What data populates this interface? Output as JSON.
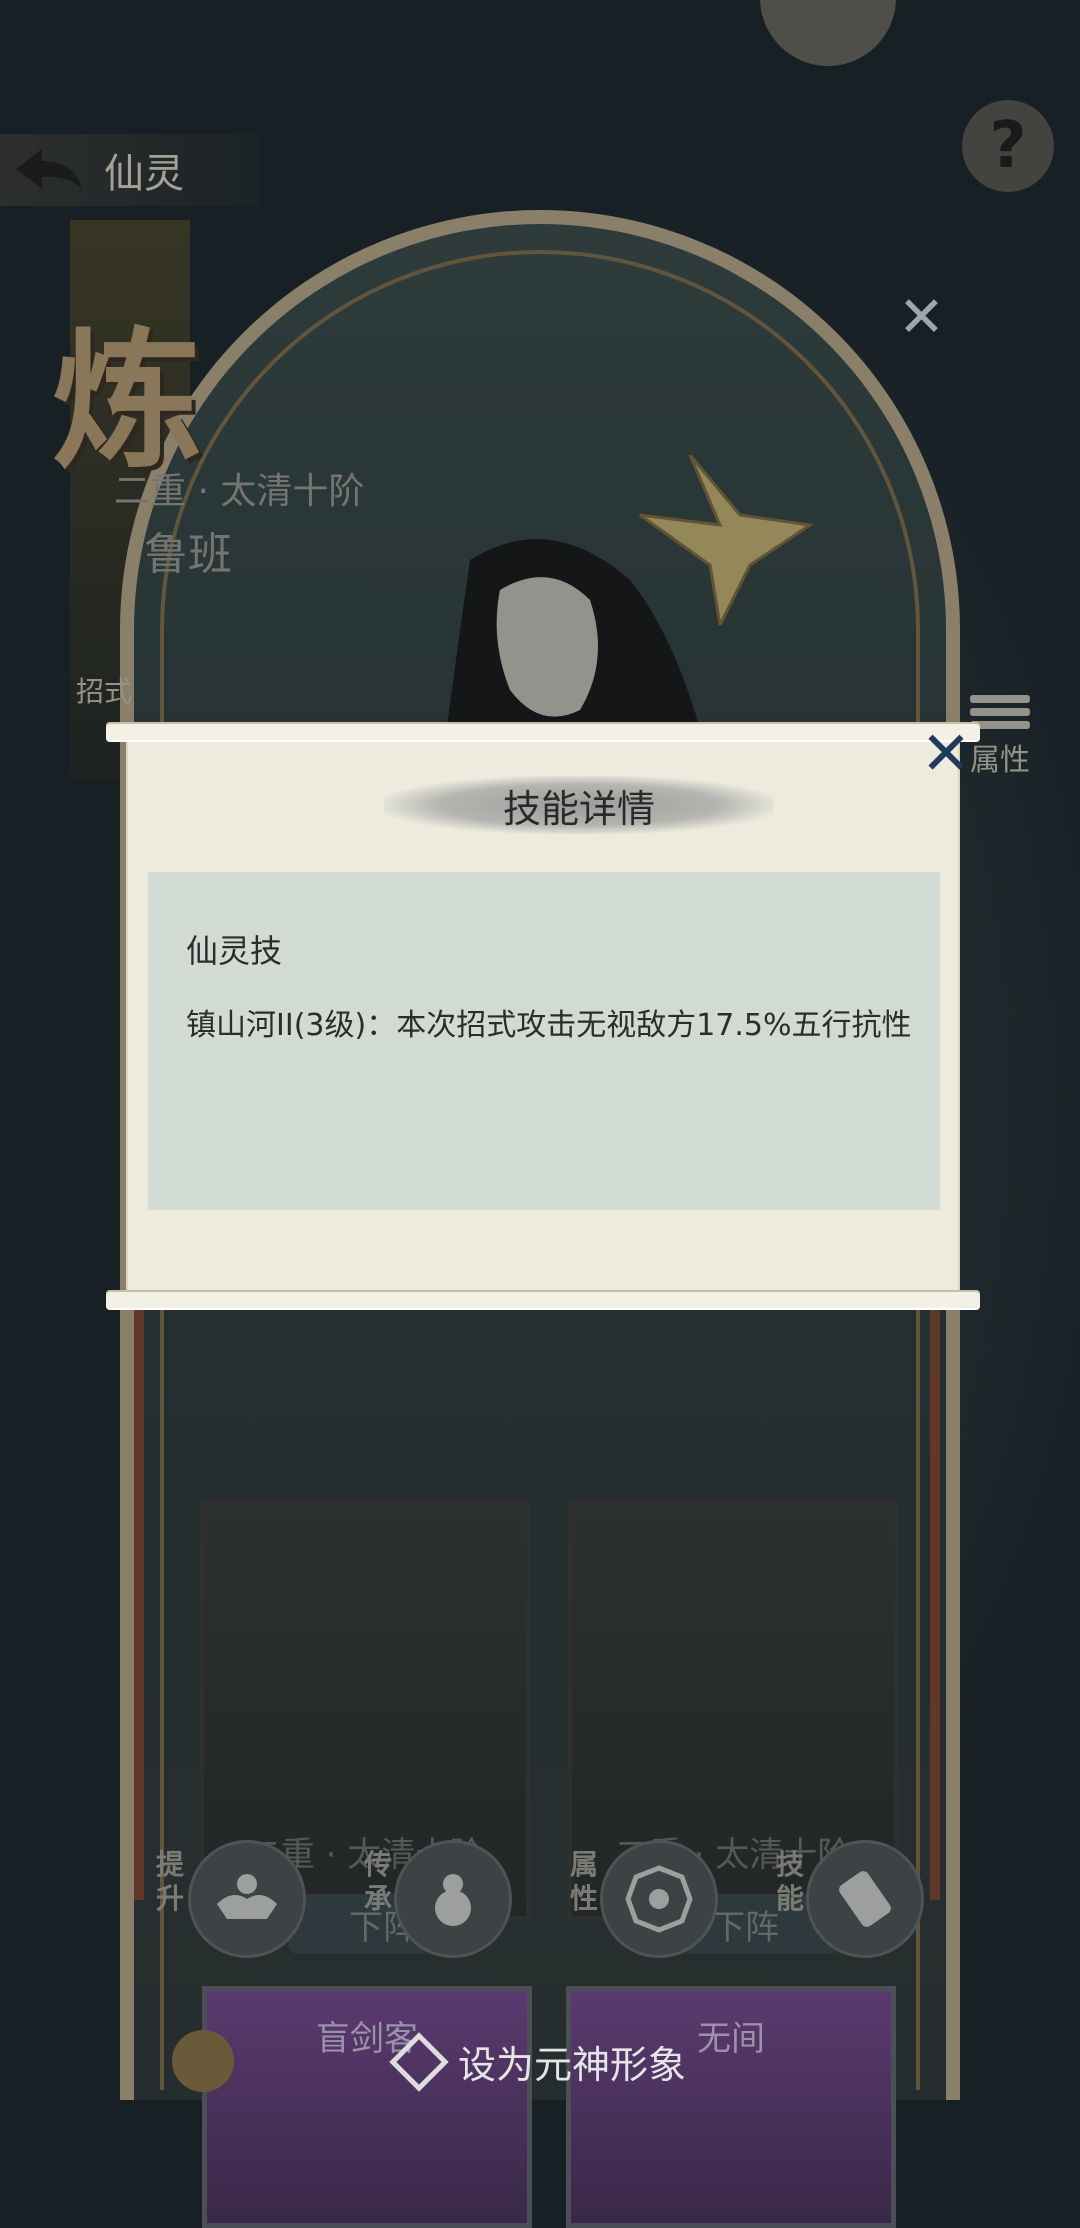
{
  "header": {
    "back_label": "仙灵"
  },
  "hero": {
    "big_char": "炼",
    "rank": "二重 · 太清十阶",
    "name": "鲁班"
  },
  "side": {
    "left_label": "招式",
    "right_label": "属性"
  },
  "modal": {
    "title": "技能详情",
    "skill_heading": "仙灵技",
    "skill_desc": "镇山河II(3级)：本次招式攻击无视敌方17.5%五行抗性"
  },
  "cards": [
    {
      "rank": "二重 · 太清十阶",
      "button": "下阵"
    },
    {
      "rank": "二重 · 太清十阶",
      "button": "下阵"
    }
  ],
  "actions": [
    {
      "label": "提升"
    },
    {
      "label": "传承"
    },
    {
      "label": "属性"
    },
    {
      "label": "技能"
    }
  ],
  "portraits": [
    {
      "name": "盲剑客"
    },
    {
      "name": "无间"
    }
  ],
  "set_avatar_label": "设为元神形象",
  "colors": {
    "modal_bg": "#ecebdd",
    "skill_panel": "#d2dbd3",
    "frame_gold": "#c9b592"
  }
}
